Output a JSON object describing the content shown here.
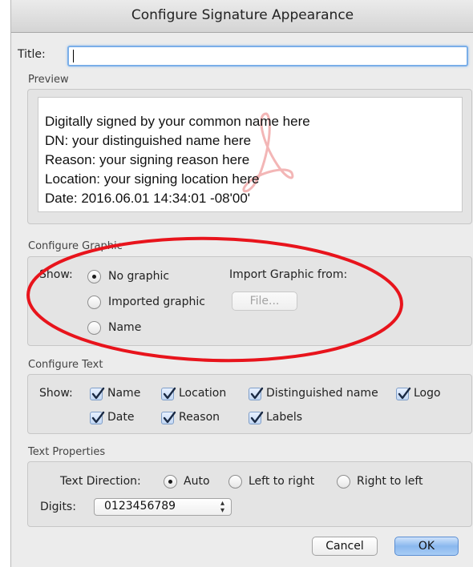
{
  "window": {
    "title": "Configure Signature Appearance"
  },
  "title_field": {
    "label": "Title:",
    "value": ""
  },
  "preview": {
    "section_label": "Preview",
    "lines": [
      "Digitally signed by your common name here",
      "DN: your distinguished name here",
      "Reason: your signing reason here",
      "Location: your signing location here",
      "Date: 2016.06.01 14:34:01 -08'00'"
    ]
  },
  "configure_graphic": {
    "section_label": "Configure Graphic",
    "show_label": "Show:",
    "options": [
      {
        "label": "No graphic",
        "selected": true
      },
      {
        "label": "Imported graphic",
        "selected": false
      },
      {
        "label": "Name",
        "selected": false
      }
    ],
    "import_label": "Import Graphic from:",
    "file_button": "File..."
  },
  "configure_text": {
    "section_label": "Configure Text",
    "show_label": "Show:",
    "checkboxes": [
      {
        "label": "Name",
        "checked": true
      },
      {
        "label": "Location",
        "checked": true
      },
      {
        "label": "Distinguished name",
        "checked": true
      },
      {
        "label": "Logo",
        "checked": true
      },
      {
        "label": "Date",
        "checked": true
      },
      {
        "label": "Reason",
        "checked": true
      },
      {
        "label": "Labels",
        "checked": true
      }
    ]
  },
  "text_properties": {
    "section_label": "Text Properties",
    "direction_label": "Text Direction:",
    "direction_options": [
      {
        "label": "Auto",
        "selected": true
      },
      {
        "label": "Left to right",
        "selected": false
      },
      {
        "label": "Right to left",
        "selected": false
      }
    ],
    "digits_label": "Digits:",
    "digits_value": "0123456789"
  },
  "buttons": {
    "cancel": "Cancel",
    "ok": "OK"
  },
  "annotation": {
    "color": "#e8141c"
  },
  "icons": {
    "select_arrows": "up-down-arrows-icon",
    "check": "checkmark-icon",
    "watermark": "acrobat-logo-watermark"
  }
}
